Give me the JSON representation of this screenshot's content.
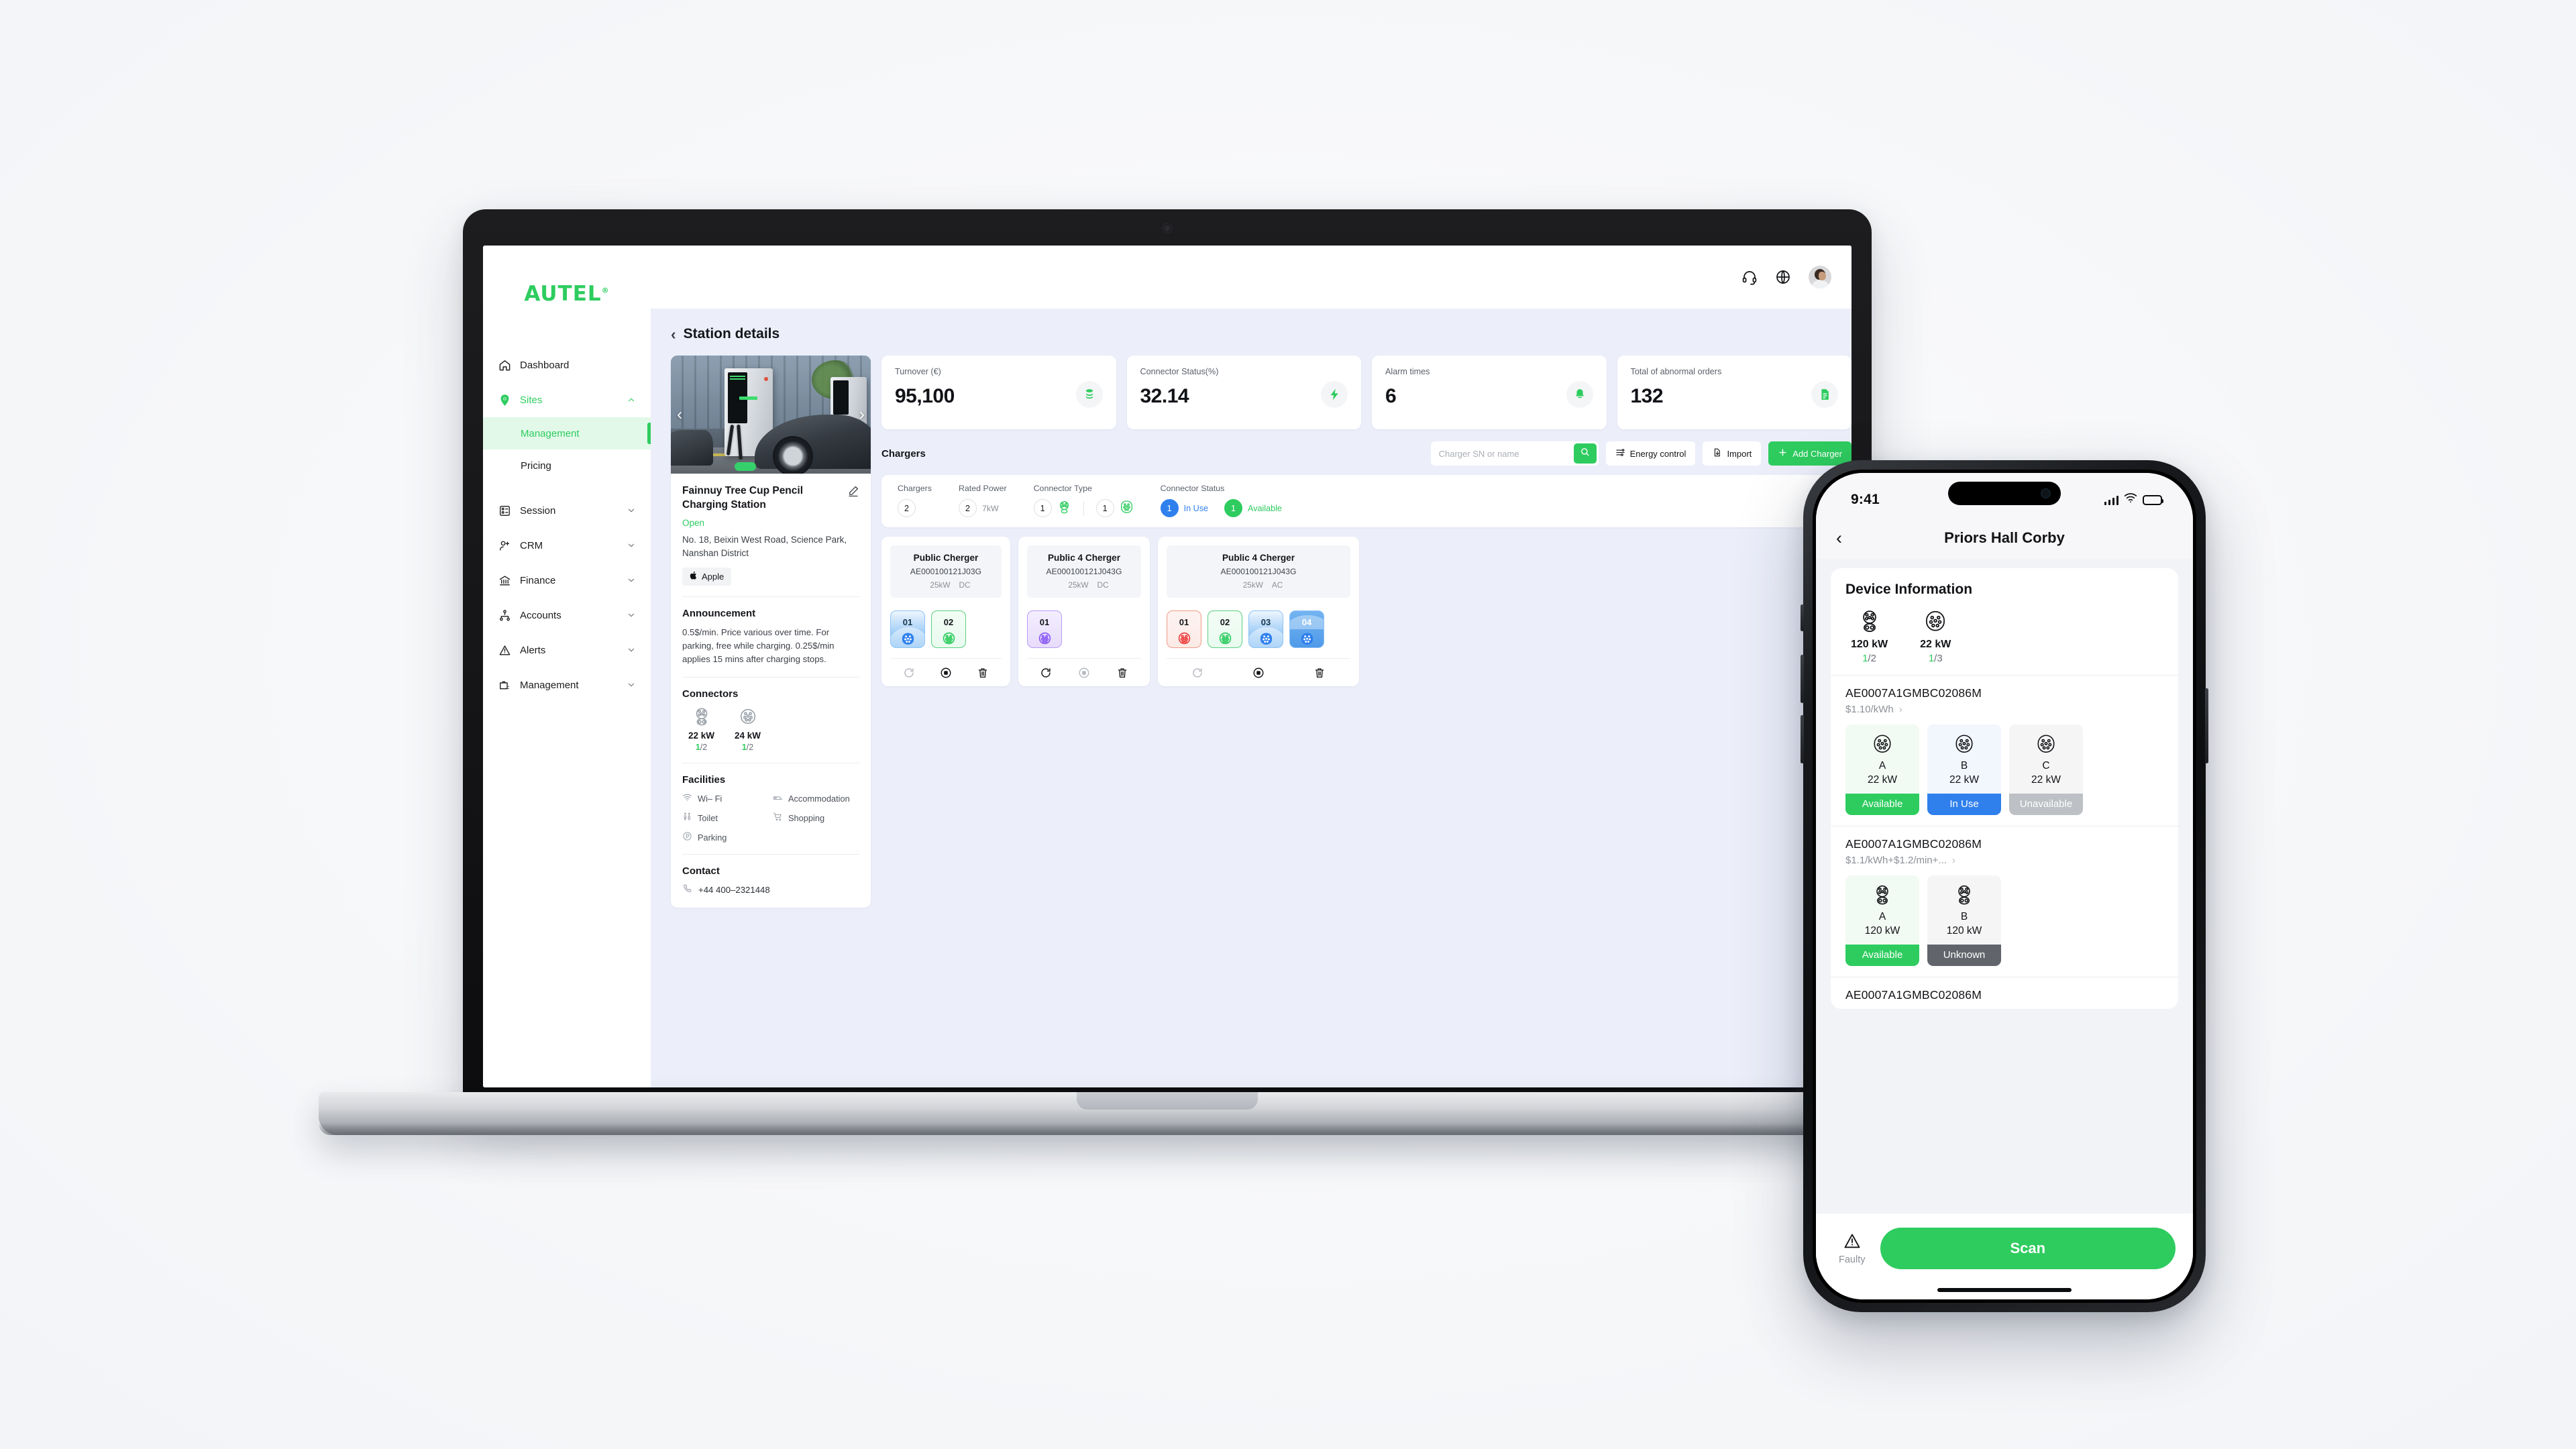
{
  "desktop": {
    "brand": "AUTEL",
    "sidebar": [
      {
        "label": "Dashboard",
        "icon": "home-icon",
        "type": "item",
        "active": false,
        "expandable": false
      },
      {
        "label": "Sites",
        "icon": "location-pin-icon",
        "type": "item",
        "active": true,
        "expandable": true
      },
      {
        "label": "Management",
        "type": "sub",
        "selected": true
      },
      {
        "label": "Pricing",
        "type": "sub",
        "selected": false
      },
      {
        "label": "Session",
        "icon": "session-icon",
        "type": "item",
        "active": false,
        "expandable": true
      },
      {
        "label": "CRM",
        "icon": "user-plus-icon",
        "type": "item",
        "active": false,
        "expandable": true
      },
      {
        "label": "Finance",
        "icon": "bank-icon",
        "type": "item",
        "active": false,
        "expandable": true
      },
      {
        "label": "Accounts",
        "icon": "org-chart-icon",
        "type": "item",
        "active": false,
        "expandable": true
      },
      {
        "label": "Alerts",
        "icon": "warning-triangle-icon",
        "type": "item",
        "active": false,
        "expandable": true
      },
      {
        "label": "Management",
        "icon": "briefcase-icon",
        "type": "item",
        "active": false,
        "expandable": true
      }
    ],
    "topbar": {
      "icons": [
        "headset-icon",
        "globe-icon"
      ],
      "avatar": "user-avatar"
    },
    "breadcrumb": "Station details",
    "kpis": [
      {
        "label": "Turnover (€)",
        "value": "95,100",
        "icon": "coins-icon"
      },
      {
        "label": "Connector Status(%)",
        "value": "32.14",
        "icon": "bolt-icon"
      },
      {
        "label": "Alarm times",
        "value": "6",
        "icon": "bell-icon"
      },
      {
        "label": "Total of abnormal orders",
        "value": "132",
        "icon": "document-icon"
      }
    ],
    "station": {
      "title": "Fainnuy Tree Cup Pencil Charging Station",
      "status": "Open",
      "address": "No. 18, Beixin West Road, Science Park, Nanshan District",
      "tag": "Apple",
      "announcement_heading": "Announcement",
      "announcement": "0.5$/min. Price various over time. For parking, free while charging. 0.25$/min applies 15 mins after charging stops.",
      "connectors_heading": "Connectors",
      "connectors": [
        {
          "power": "22 kW",
          "used": "1",
          "total": "/2",
          "icon": "ccs-connector-icon"
        },
        {
          "power": "24 kW",
          "used": "1",
          "total": "/2",
          "icon": "type2-connector-icon"
        }
      ],
      "facilities_heading": "Facilities",
      "facilities": [
        {
          "label": "Wi– Fi",
          "icon": "wifi-icon"
        },
        {
          "label": "Accommodation",
          "icon": "bed-icon"
        },
        {
          "label": "Toilet",
          "icon": "toilet-icon"
        },
        {
          "label": "Shopping",
          "icon": "cart-icon"
        },
        {
          "label": "Parking",
          "icon": "parking-icon"
        }
      ],
      "contact_heading": "Contact",
      "phone": "+44 400–2321448"
    },
    "toolbar": {
      "title": "Chargers",
      "search_placeholder": "Charger SN or name",
      "search_value": "",
      "energy_control": "Energy control",
      "import": "Import",
      "add_charger": "Add Charger"
    },
    "filters": [
      {
        "heading": "Chargers",
        "count": "2",
        "unit": ""
      },
      {
        "heading": "Rated Power",
        "count": "2",
        "unit": "7kW"
      },
      {
        "heading": "Connector Type",
        "items": [
          {
            "count": "1",
            "icon": "ccs-icon"
          },
          {
            "count": "1",
            "icon": "type2-icon"
          }
        ]
      },
      {
        "heading": "Connector Status",
        "items": [
          {
            "count": "1",
            "label": "In Use",
            "color": "#2f80ed"
          },
          {
            "count": "1",
            "label": "Available",
            "color": "#2ecc5f"
          }
        ]
      }
    ],
    "charger_cards": [
      {
        "name": "Public Cherger",
        "sn": "AE000100121J03G",
        "power": "25kW",
        "current": "DC",
        "connectors": [
          {
            "num": "01",
            "state": "blue"
          },
          {
            "num": "02",
            "state": "green"
          }
        ],
        "actions": [
          "refresh-icon",
          "stop-icon",
          "delete-icon"
        ]
      },
      {
        "name": "Public 4 Cherger",
        "sn": "AE000100121J043G",
        "power": "25kW",
        "current": "DC",
        "connectors": [
          {
            "num": "01",
            "state": "purple"
          }
        ],
        "actions": [
          "refresh-icon",
          "stop-icon",
          "delete-icon"
        ]
      },
      {
        "name": "Public 4 Cherger",
        "sn": "AE000100121J043G",
        "power": "25kW",
        "current": "AC",
        "connectors": [
          {
            "num": "01",
            "state": "red"
          },
          {
            "num": "02",
            "state": "green"
          },
          {
            "num": "03",
            "state": "blue"
          },
          {
            "num": "04",
            "state": "blue-deep"
          }
        ],
        "actions": [
          "refresh-icon",
          "stop-icon",
          "delete-icon"
        ]
      }
    ]
  },
  "phone": {
    "status": {
      "time": "9:41",
      "signal": "cellular-icon",
      "wifi": "wifi-icon",
      "battery": "battery-icon"
    },
    "nav": {
      "back": "‹",
      "title": "Priors Hall Corby"
    },
    "device_info": {
      "heading": "Device Information",
      "items": [
        {
          "power": "120 kW",
          "used": "1",
          "total": "/2",
          "icon": "ccs2-connector-icon"
        },
        {
          "power": "22 kW",
          "used": "1",
          "total": "/3",
          "icon": "type2-connector-icon"
        }
      ]
    },
    "chargers": [
      {
        "sn": "AE0007A1GMBC02086M",
        "price": "$1.10/kWh",
        "plugs": [
          {
            "id": "A",
            "power": "22 kW",
            "status": "Available",
            "state": "avail",
            "icon": "type2-connector-icon"
          },
          {
            "id": "B",
            "power": "22 kW",
            "status": "In Use",
            "state": "inuse",
            "icon": "type2-connector-icon"
          },
          {
            "id": "C",
            "power": "22 kW",
            "status": "Unavailable",
            "state": "unav",
            "icon": "type2-connector-icon"
          }
        ]
      },
      {
        "sn": "AE0007A1GMBC02086M",
        "price": "$1.1/kWh+$1.2/min+...",
        "plugs": [
          {
            "id": "A",
            "power": "120 kW",
            "status": "Available",
            "state": "avail",
            "icon": "ccs2-connector-icon"
          },
          {
            "id": "B",
            "power": "120 kW",
            "status": "Unknown",
            "state": "unk",
            "icon": "ccs2-connector-icon"
          }
        ]
      },
      {
        "sn": "AE0007A1GMBC02086M",
        "price": "",
        "plugs": []
      }
    ],
    "bottom": {
      "faulty": "Faulty",
      "faulty_icon": "warning-triangle-icon",
      "scan": "Scan"
    }
  },
  "colors": {
    "brand_green": "#2ecc5f",
    "blue": "#2f80ed",
    "grey": "#bdc0c4",
    "dark_grey": "#61656b"
  }
}
